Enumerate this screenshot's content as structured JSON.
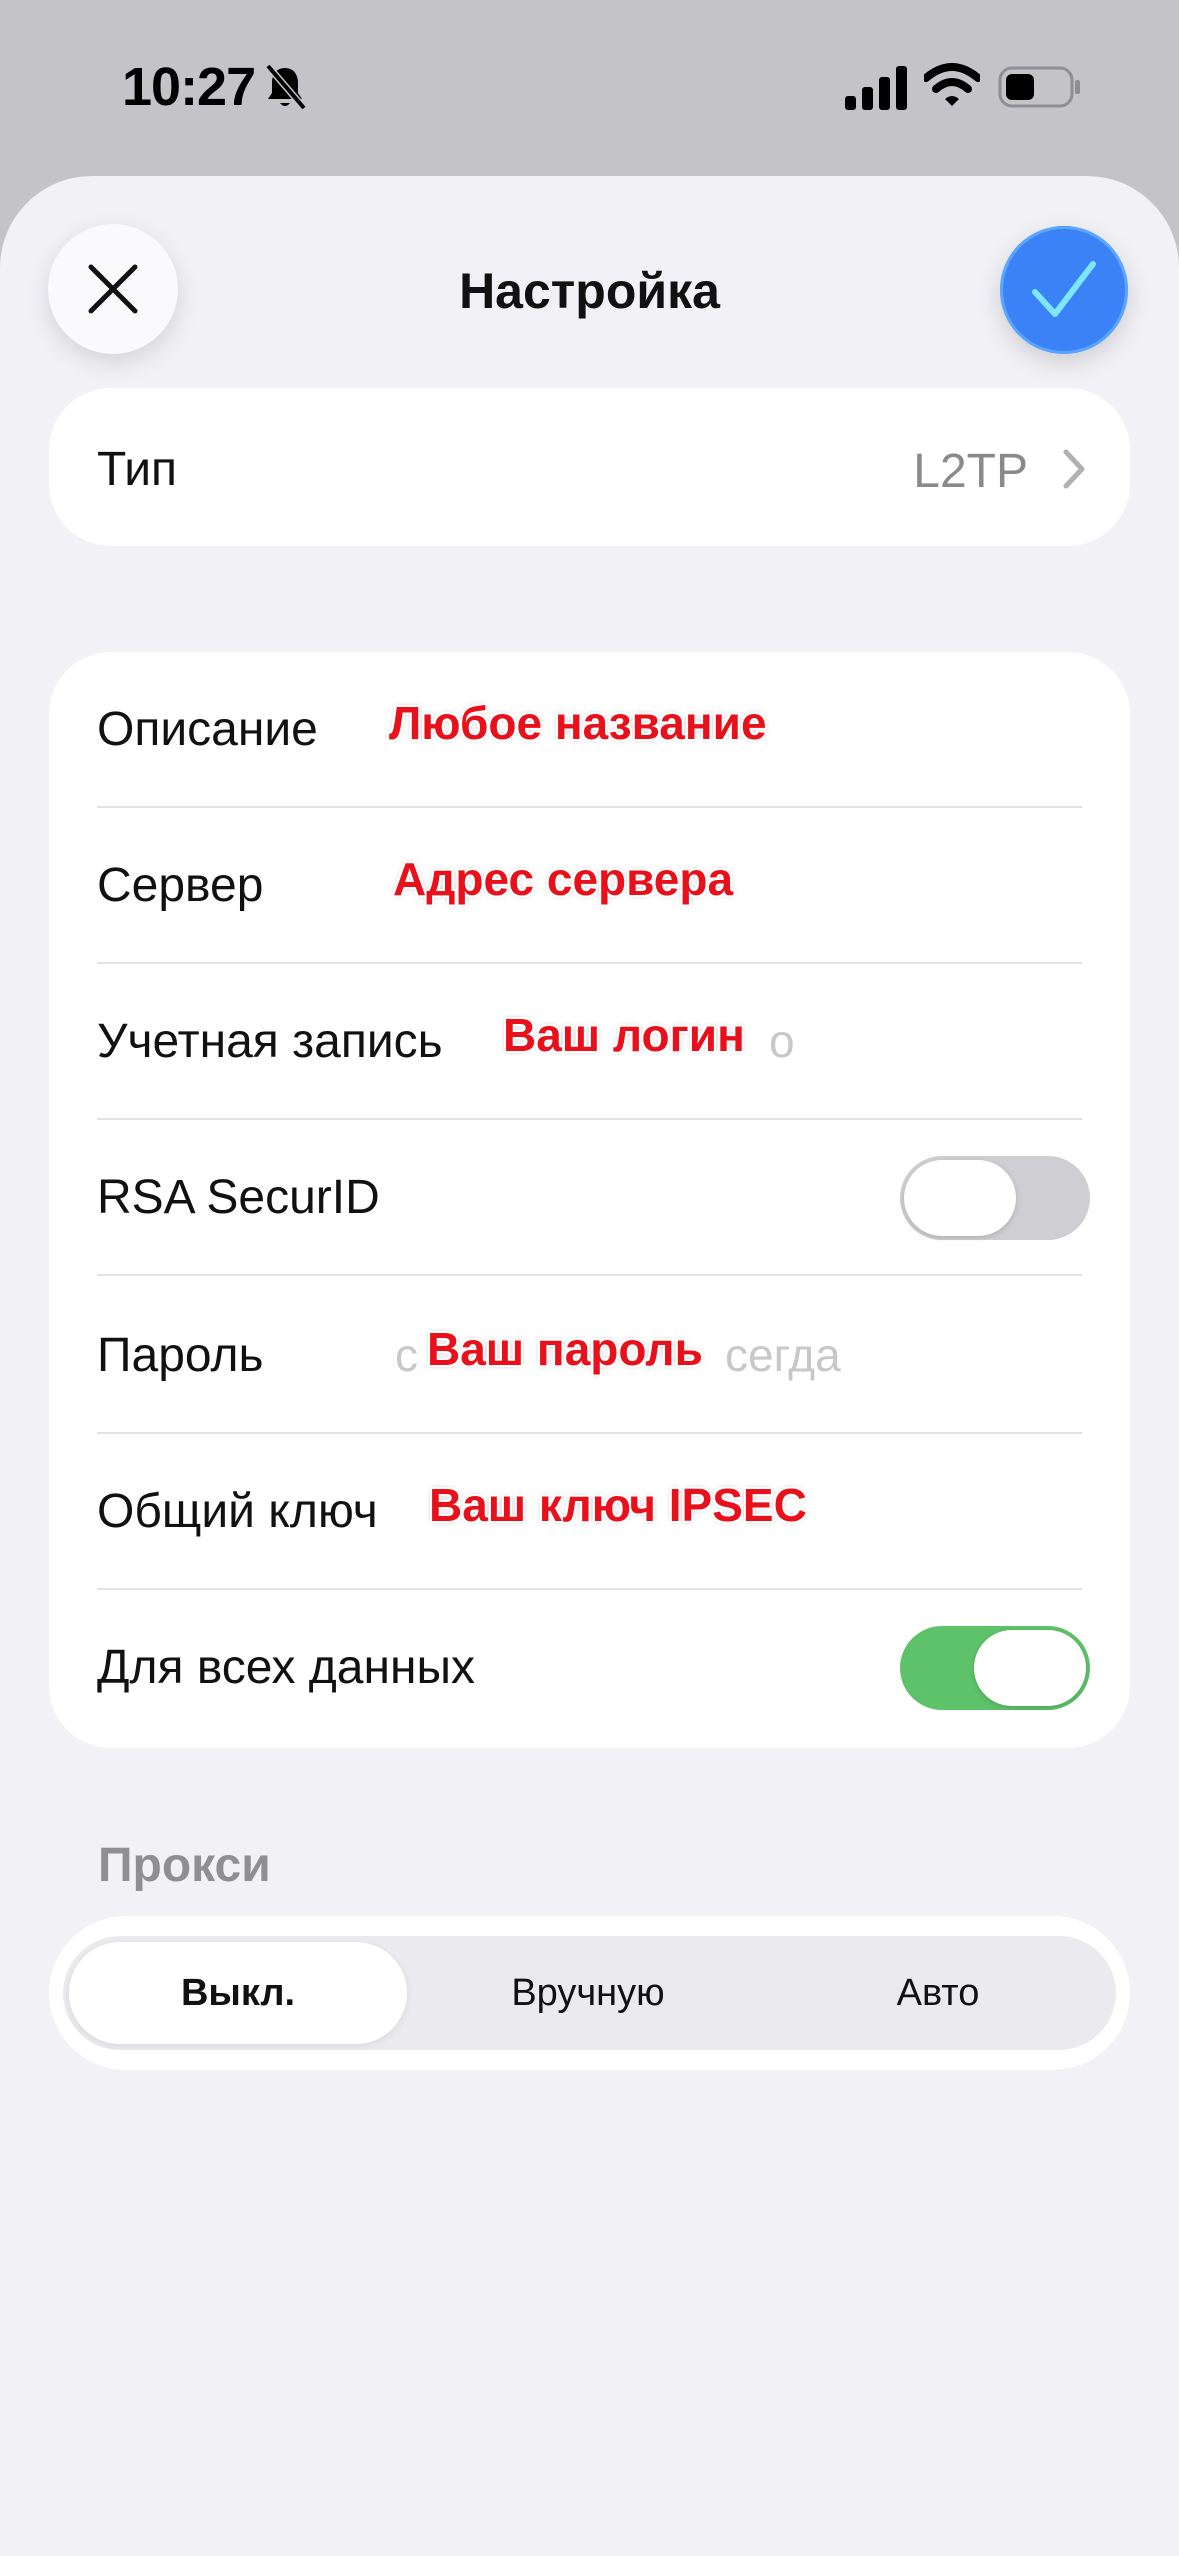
{
  "status_bar": {
    "time": "10:27"
  },
  "header": {
    "title": "Настройка"
  },
  "type_row": {
    "label": "Тип",
    "value": "L2TP"
  },
  "form": {
    "description": {
      "label": "Описание",
      "hint": "Любое название"
    },
    "server": {
      "label": "Сервер",
      "hint": "Адрес сервера"
    },
    "account": {
      "label": "Учетная запись",
      "ghost": "о",
      "hint": "Ваш логин"
    },
    "rsa": {
      "label": "RSA SecurID",
      "enabled": false
    },
    "password": {
      "label": "Пароль",
      "ghost_left": "с",
      "ghost_right": "сегда",
      "hint": "Ваш пароль"
    },
    "shared_key": {
      "label": "Общий ключ",
      "hint": "Ваш ключ IPSEC"
    },
    "all_traffic": {
      "label": "Для всех данных",
      "enabled": true
    }
  },
  "proxy": {
    "header": "Прокси",
    "options": [
      "Выкл.",
      "Вручную",
      "Авто"
    ],
    "selected": "Выкл."
  },
  "colors": {
    "accent": "#3a82f6",
    "toggle_on": "#5ec26a",
    "hint": "#e8101a"
  }
}
